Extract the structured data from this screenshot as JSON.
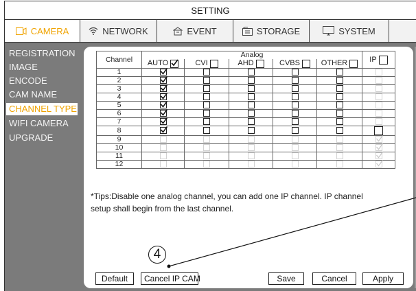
{
  "window": {
    "title": "SETTING"
  },
  "tabs": [
    {
      "label": "CAMERA",
      "icon": "camera-icon",
      "active": true
    },
    {
      "label": "NETWORK",
      "icon": "wifi-icon",
      "active": false
    },
    {
      "label": "EVENT",
      "icon": "event-icon",
      "active": false
    },
    {
      "label": "STORAGE",
      "icon": "storage-icon",
      "active": false
    },
    {
      "label": "SYSTEM",
      "icon": "monitor-icon",
      "active": false
    }
  ],
  "sidebar": {
    "items": [
      {
        "label": "REGISTRATION",
        "active": false
      },
      {
        "label": "IMAGE",
        "active": false
      },
      {
        "label": "ENCODE",
        "active": false
      },
      {
        "label": "CAM NAME",
        "active": false
      },
      {
        "label": "CHANNEL TYPE",
        "active": true
      },
      {
        "label": "WIFI CAMERA",
        "active": false
      },
      {
        "label": "UPGRADE",
        "active": false
      }
    ]
  },
  "table": {
    "channel_header": "Channel",
    "analog_header": "Analog",
    "columns": [
      "AUTO",
      "CVI",
      "AHD",
      "CVBS",
      "OTHER"
    ],
    "ip_header": "IP",
    "header_checks": {
      "AUTO": true,
      "CVI": false,
      "AHD": false,
      "CVBS": false,
      "OTHER": false,
      "IP": false
    },
    "rows": [
      {
        "channel": "1",
        "auto": true,
        "cvi": false,
        "ahd": false,
        "cvbs": false,
        "other": false,
        "ip": "disabled-empty"
      },
      {
        "channel": "2",
        "auto": true,
        "cvi": false,
        "ahd": false,
        "cvbs": false,
        "other": false,
        "ip": "disabled-empty"
      },
      {
        "channel": "3",
        "auto": true,
        "cvi": false,
        "ahd": false,
        "cvbs": false,
        "other": false,
        "ip": "disabled-empty"
      },
      {
        "channel": "4",
        "auto": true,
        "cvi": false,
        "ahd": false,
        "cvbs": false,
        "other": false,
        "ip": "disabled-empty"
      },
      {
        "channel": "5",
        "auto": true,
        "cvi": false,
        "ahd": false,
        "cvbs": false,
        "other": false,
        "ip": "disabled-empty"
      },
      {
        "channel": "6",
        "auto": true,
        "cvi": false,
        "ahd": false,
        "cvbs": false,
        "other": false,
        "ip": "disabled-empty"
      },
      {
        "channel": "7",
        "auto": true,
        "cvi": false,
        "ahd": false,
        "cvbs": false,
        "other": false,
        "ip": "disabled-empty"
      },
      {
        "channel": "8",
        "auto": true,
        "cvi": false,
        "ahd": false,
        "cvbs": false,
        "other": false,
        "ip": "empty"
      },
      {
        "channel": "9",
        "analog_disabled": true,
        "ip": "disabled-checked"
      },
      {
        "channel": "10",
        "analog_disabled": true,
        "ip": "disabled-checked"
      },
      {
        "channel": "11",
        "analog_disabled": true,
        "ip": "disabled-checked"
      },
      {
        "channel": "12",
        "analog_disabled": true,
        "ip": "disabled-checked"
      }
    ]
  },
  "tips": "*Tips:Disable one analog channel, you can add one IP channel. IP channel setup shall begin from the last channel.",
  "buttons": {
    "default": "Default",
    "cancel_ip": "Cancel IP CAM",
    "save": "Save",
    "cancel": "Cancel",
    "apply": "Apply"
  },
  "annotation": {
    "number": "4"
  },
  "colors": {
    "accent": "#f0a300",
    "sidebar_bg": "#7b7b7b",
    "disabled_border": "#d2d2d2"
  }
}
